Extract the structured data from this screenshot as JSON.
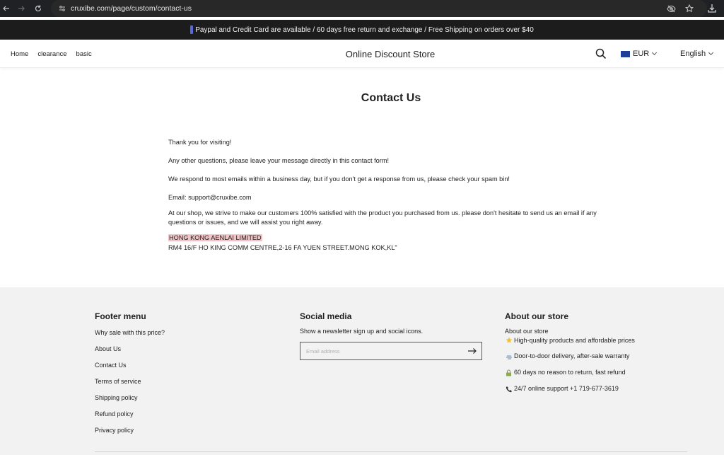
{
  "browser": {
    "url": "cruxibe.com/page/custom/contact-us",
    "icons": [
      "back-icon",
      "forward-icon",
      "reload-icon",
      "site-settings-icon",
      "eye-slash-icon",
      "star-icon",
      "download-icon"
    ]
  },
  "announcement": {
    "text": "Paypal and Credit Card are available / 60 days free return and exchange / Free Shipping on orders over $40"
  },
  "header": {
    "nav": [
      {
        "label": "Home"
      },
      {
        "label": "clearance"
      },
      {
        "label": "basic"
      }
    ],
    "store_name": "Online Discount Store",
    "currency": "EUR",
    "language": "English"
  },
  "main": {
    "title": "Contact Us",
    "paragraphs": [
      "Thank you for visiting!",
      "Any other questions, please leave your message directly in this contact form!",
      "We respond to most emails within a business day, but if you don't get a response from us, please check your spam bin!",
      "Email: support@cruxibe.com",
      "At our shop, we strive to make our customers 100% satisfied with the product you purchased from us. please don't hesitate to send us an email if any questions or issues, and we will assist you right away."
    ],
    "company_name": "HONG KONG AENLAI LIMITED",
    "company_address": "RM4 16/F HO KING COMM CENTRE,2-16 FA YUEN STREET.MONG KOK,KL\""
  },
  "footer": {
    "menu": {
      "heading": "Footer menu",
      "links": [
        {
          "label": "Why sale with this price?"
        },
        {
          "label": "About Us"
        },
        {
          "label": "Contact Us"
        },
        {
          "label": "Terms of service"
        },
        {
          "label": "Shipping policy"
        },
        {
          "label": "Refund policy"
        },
        {
          "label": "Privacy policy"
        }
      ]
    },
    "social": {
      "heading": "Social media",
      "description": "Show a newsletter sign up and social icons.",
      "email_placeholder": "Email address",
      "email_value": ""
    },
    "about": {
      "heading": "About our store",
      "subtitle": "About our store",
      "items": [
        {
          "icon": "star-icon",
          "text": "High-quality products and affordable prices"
        },
        {
          "icon": "delivery-icon",
          "text": "Door-to-door delivery, after-sale warranty"
        },
        {
          "icon": "lock-icon",
          "text": "60 days no reason to return, fast refund"
        },
        {
          "icon": "phone-icon",
          "text": "24/7 online support +1 719-677-3619"
        }
      ]
    }
  },
  "colors": {
    "announcement_bg": "#1c1c1c",
    "footer_bg": "#f2f2f2",
    "highlight": "#f2c4c8",
    "browser_bg": "#202124"
  }
}
